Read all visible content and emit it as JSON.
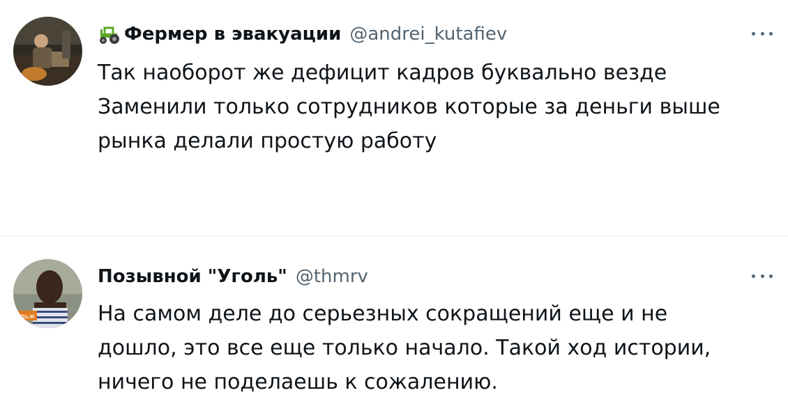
{
  "tweets": [
    {
      "author_name": "Фермер в эвакуации",
      "author_emoji": "tractor-icon",
      "handle": "@andrei_kutafiev",
      "text_lines": [
        "Так наоборот же дефицит кадров буквально везде",
        "Заменили только сотрудников которые за деньги выше",
        "рынка делали простую работу"
      ]
    },
    {
      "author_name": "Позывной \"Уголь\"",
      "handle": "@thmrv",
      "avatar_caption": "ольж",
      "text_lines": [
        "На самом деле до серьезных сокращений еще и не",
        "дошло, это все еще только начало. Такой ход истории,",
        "ничего не поделаешь к сожалению."
      ]
    }
  ],
  "colors": {
    "name": "#0f1419",
    "handle": "#536471",
    "divider": "#eff3f4",
    "emoji_green": "#5aa829"
  }
}
